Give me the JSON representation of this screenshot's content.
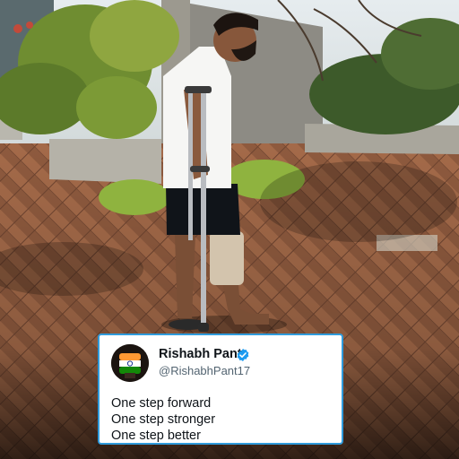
{
  "tweet": {
    "display_name": "Rishabh Pant",
    "handle": "@RishabhPant17",
    "verified_icon": "verified-badge-icon",
    "accent_color": "#1d9bf0",
    "lines": [
      "One step forward",
      "One step stronger",
      "One step better"
    ]
  },
  "avatar": {
    "icon": "flag-fist-icon",
    "colors": [
      "#ff9933",
      "#ffffff",
      "#138808"
    ]
  }
}
